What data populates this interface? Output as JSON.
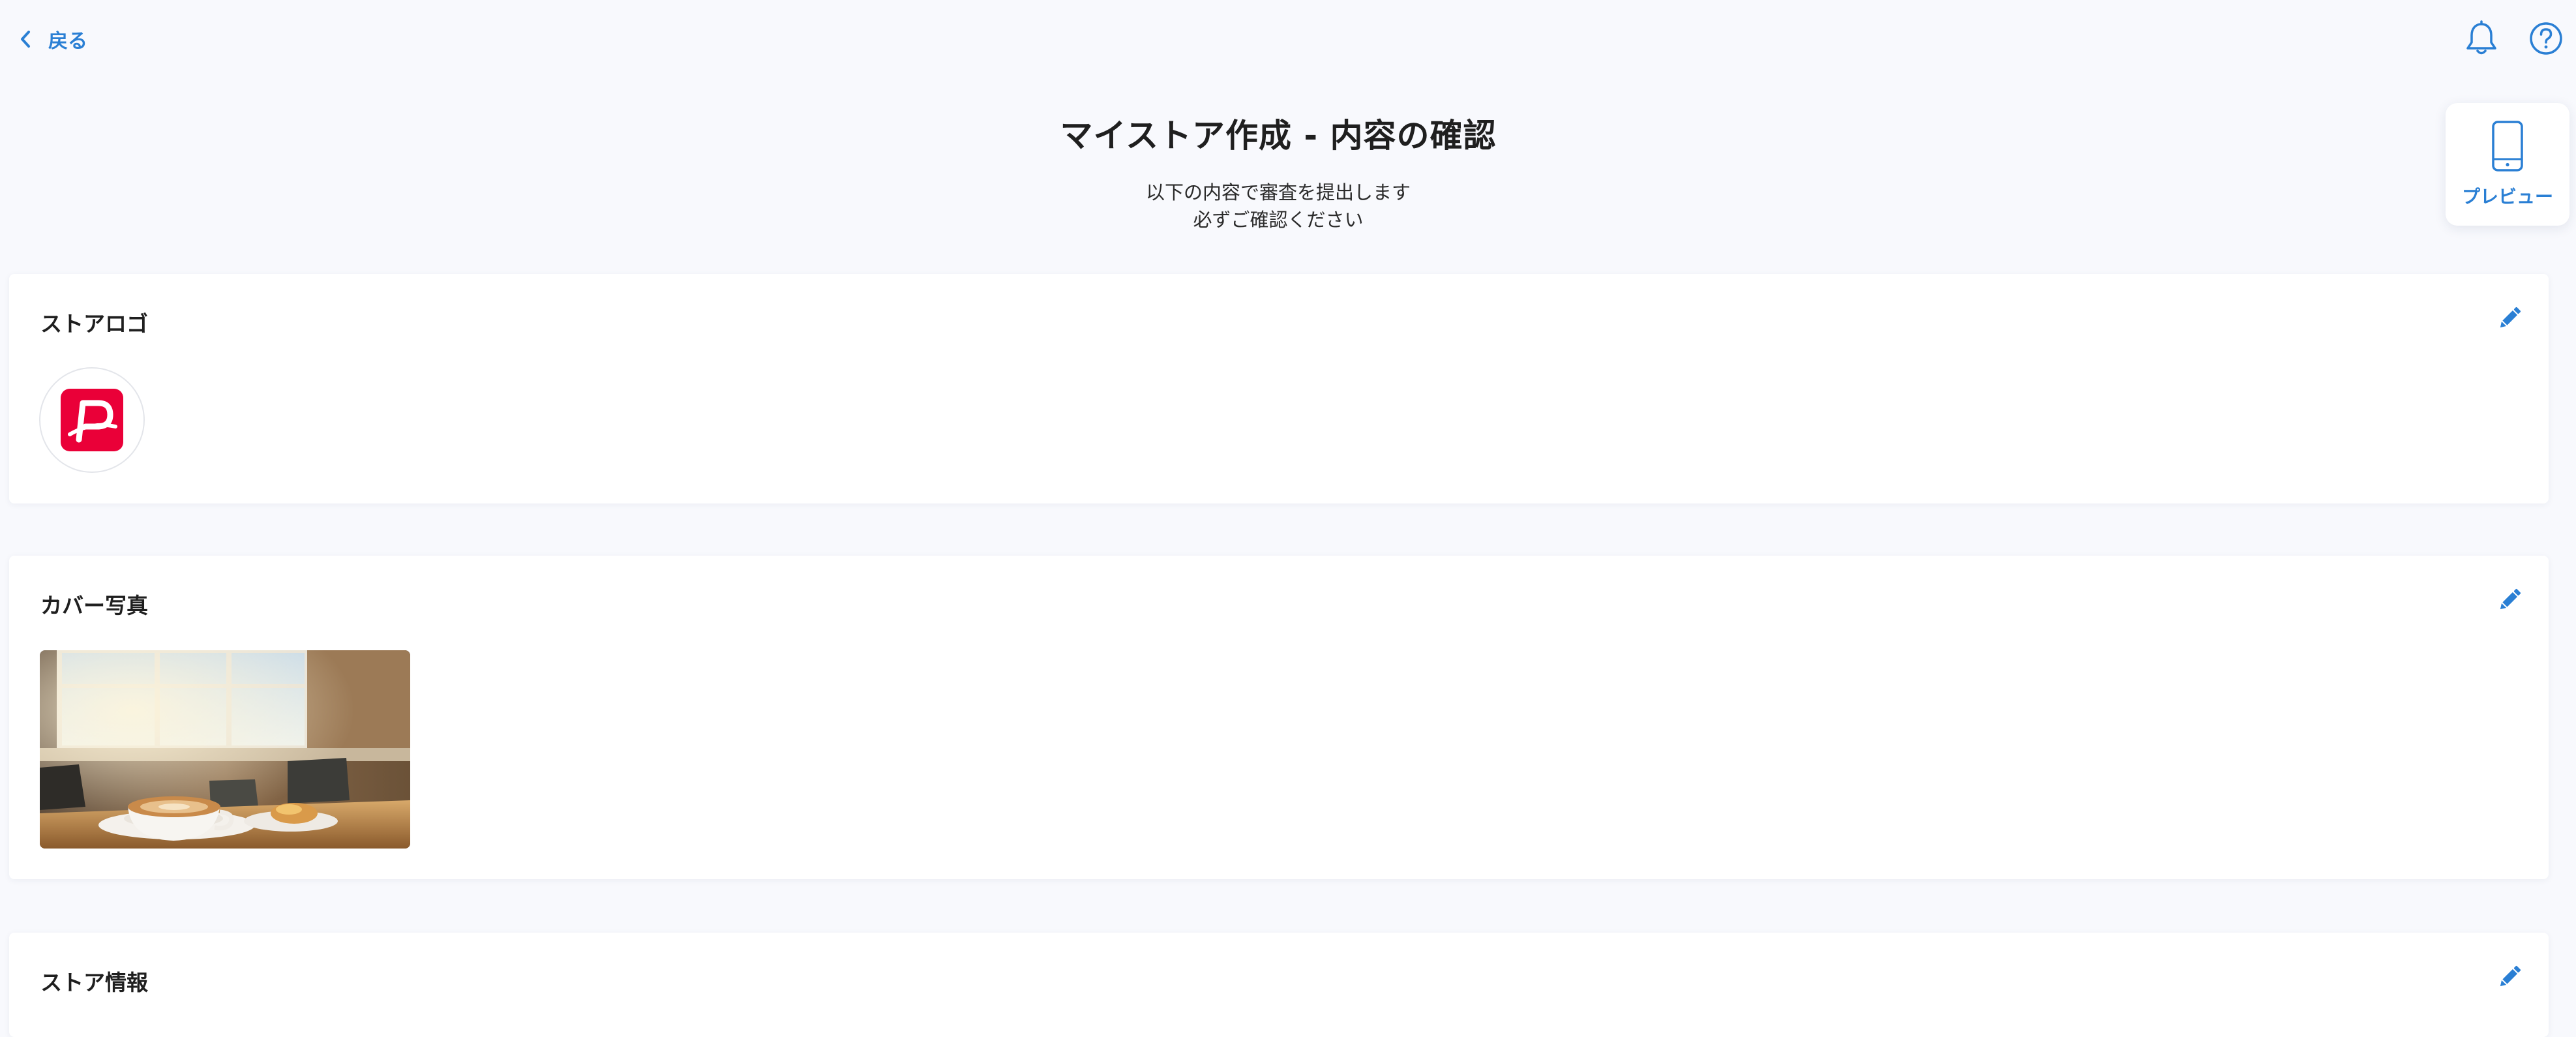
{
  "nav": {
    "back_label": "戻る"
  },
  "header": {
    "title": "マイストア作成 - 内容の確認",
    "subtitle_line1": "以下の内容で審査を提出します",
    "subtitle_line2": "必ずご確認ください"
  },
  "preview": {
    "label": "プレビュー"
  },
  "sections": {
    "logo": {
      "title": "ストアロゴ"
    },
    "cover": {
      "title": "カバー写真"
    },
    "info": {
      "title": "ストア情報"
    }
  },
  "colors": {
    "accent": "#2a7fd4",
    "brand_logo": "#ea0038",
    "background": "#f8f9fd"
  },
  "icons": {
    "back": "chevron-left-icon",
    "notifications": "bell-icon",
    "help": "question-circle-icon",
    "preview": "smartphone-icon",
    "edit": "pencil-icon"
  }
}
